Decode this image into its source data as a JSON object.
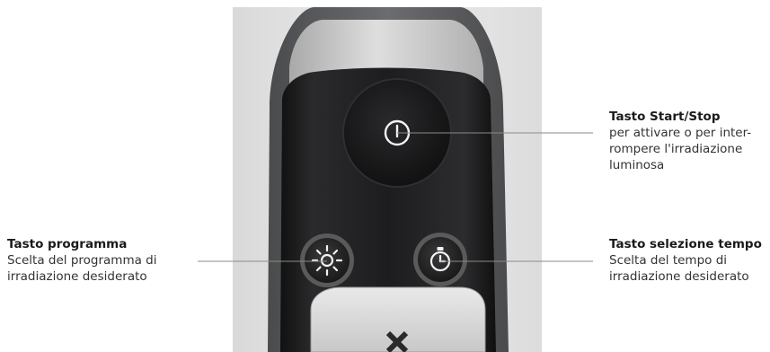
{
  "colors": {
    "background": "#ffffff",
    "device_body": "#1c1c1e",
    "device_band": "#cfcfcf",
    "button_ring": "#5a5a5a",
    "icon": "#f2f2f2",
    "leader_line": "#8a8a8a"
  },
  "icons": {
    "start_stop": "power-icon",
    "program": "sun-icon",
    "time_select": "stopwatch-icon",
    "cancel": "x-icon"
  },
  "callouts": {
    "start_stop": {
      "title": "Tasto Start/Stop",
      "lines": [
        "per attivare o per inter-",
        "rompere l'irradiazione",
        "luminosa"
      ]
    },
    "program": {
      "title": "Tasto programma",
      "lines": [
        "Scelta del programma di",
        "irradiazione desiderato"
      ]
    },
    "time_select": {
      "title": "Tasto selezione tempo",
      "lines": [
        "Scelta del tempo di",
        "irradiazione desiderato"
      ]
    }
  }
}
